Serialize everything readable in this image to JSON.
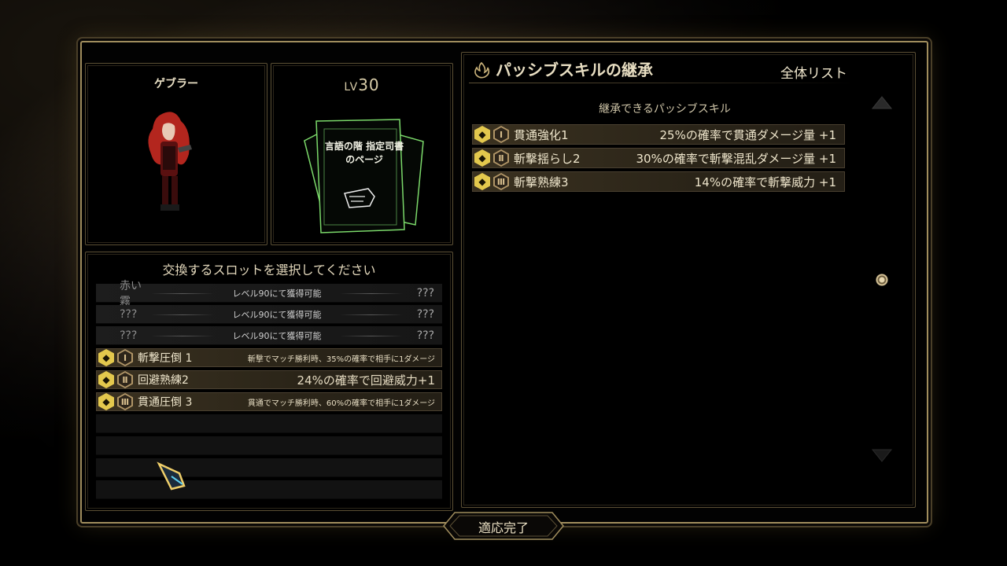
{
  "character": {
    "name": "ゲブラー"
  },
  "page": {
    "level_prefix": "LV",
    "level": "30",
    "title": "言語の階 指定司書のページ"
  },
  "slots": {
    "heading": "交換するスロットを選択してください",
    "locked": [
      {
        "left": "赤い霧",
        "mid": "レベル90にて獲得可能",
        "right": "???"
      },
      {
        "left": "???",
        "mid": "レベル90にて獲得可能",
        "right": "???"
      },
      {
        "left": "???",
        "mid": "レベル90にて獲得可能",
        "right": "???"
      }
    ],
    "skills": [
      {
        "badge": "◆",
        "rank": "Ⅰ",
        "name": "斬撃圧倒 1",
        "desc": "斬撃でマッチ勝利時、35%の確率で相手に1ダメージ"
      },
      {
        "badge": "◆",
        "rank": "Ⅱ",
        "name": "回避熟練2",
        "desc": "24%の確率で回避威力+1"
      },
      {
        "badge": "◆",
        "rank": "Ⅲ",
        "name": "貫通圧倒 3",
        "desc": "貫通でマッチ勝利時、60%の確率で相手に1ダメージ"
      }
    ]
  },
  "passive": {
    "title": "パッシブスキルの継承",
    "all_list": "全体リスト",
    "subheading": "継承できるパッシブスキル",
    "skills": [
      {
        "badge": "◆",
        "rank": "Ⅰ",
        "name": "貫通強化1",
        "desc": "25%の確率で貫通ダメージ量 +1"
      },
      {
        "badge": "◆",
        "rank": "Ⅱ",
        "name": "斬撃揺らし2",
        "desc": "30%の確率で斬撃混乱ダメージ量 +1"
      },
      {
        "badge": "◆",
        "rank": "Ⅲ",
        "name": "斬撃熟練3",
        "desc": "14%の確率で斬撃威力 +1"
      }
    ]
  },
  "confirm_label": "適応完了",
  "colors": {
    "gold_badge": "#e3c84d",
    "rank_frame": "#b09567",
    "frame_border": "#a08d5d",
    "page_glow": "#7bd96a"
  }
}
